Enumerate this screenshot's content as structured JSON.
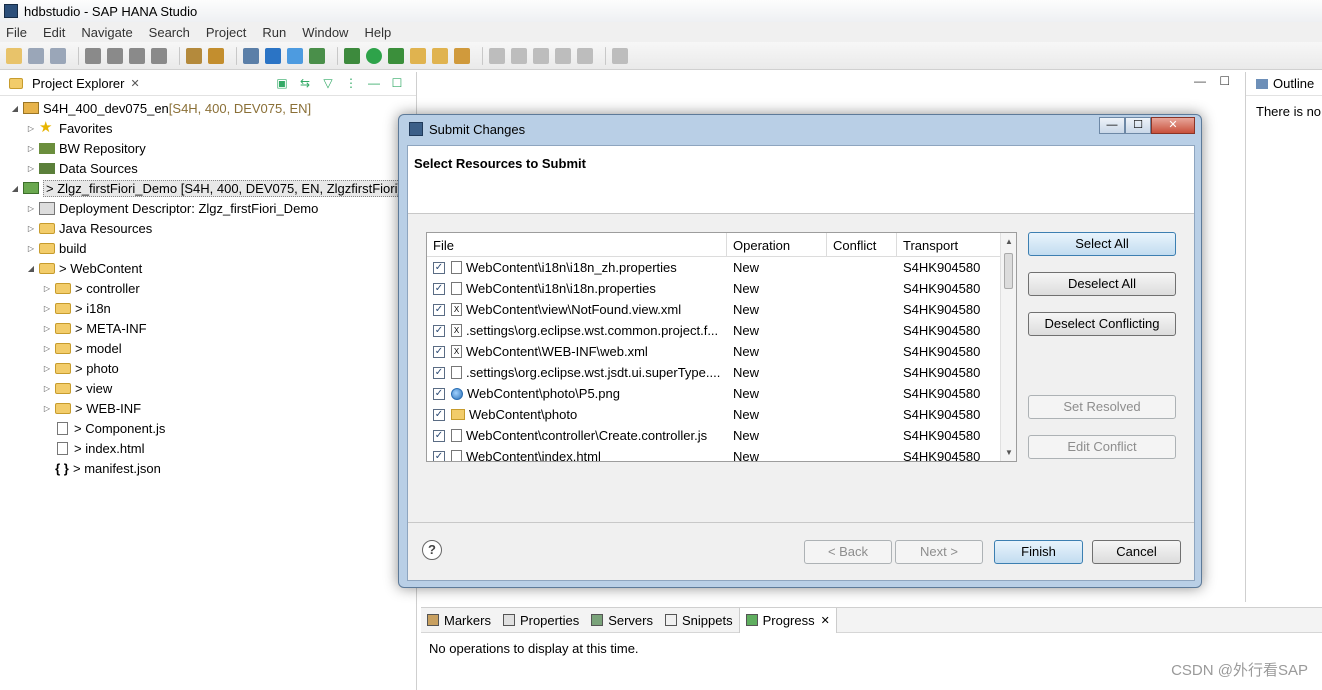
{
  "window": {
    "title": "hdbstudio - SAP HANA Studio"
  },
  "menu": [
    "File",
    "Edit",
    "Navigate",
    "Search",
    "Project",
    "Run",
    "Window",
    "Help"
  ],
  "explorer": {
    "tab_label": "Project Explorer",
    "close_glyph": "✕",
    "tree": [
      {
        "label": "S4H_400_dev075_en",
        "suffix": " [S4H, 400, DEV075, EN]"
      },
      {
        "label": "Favorites"
      },
      {
        "label": "BW Repository"
      },
      {
        "label": "Data Sources"
      },
      {
        "label": "> Zlgz_firstFiori_Demo [S4H, 400, DEV075, EN, ZlgzfirstFiori]"
      },
      {
        "label": "Deployment Descriptor: Zlgz_firstFiori_Demo"
      },
      {
        "label": "Java Resources"
      },
      {
        "label": "build"
      },
      {
        "label": "> WebContent"
      },
      {
        "label": "> controller"
      },
      {
        "label": "> i18n"
      },
      {
        "label": "> META-INF"
      },
      {
        "label": "> model"
      },
      {
        "label": "> photo"
      },
      {
        "label": "> view"
      },
      {
        "label": "> WEB-INF"
      },
      {
        "label": "> Component.js"
      },
      {
        "label": "> index.html"
      },
      {
        "label": "> manifest.json"
      }
    ]
  },
  "outline": {
    "tab_label": "Outline",
    "message": "There is no"
  },
  "bottom_panel": {
    "tabs": [
      "Markers",
      "Properties",
      "Servers",
      "Snippets",
      "Progress"
    ],
    "message": "No operations to display at this time."
  },
  "dialog": {
    "title": "Submit Changes",
    "heading": "Select Resources to Submit",
    "columns": [
      "File",
      "Operation",
      "Conflict",
      "Transport"
    ],
    "rows": [
      {
        "file": "WebContent\\i18n\\i18n_zh.properties",
        "operation": "New",
        "conflict": "",
        "transport": "S4HK904580",
        "icon": "file"
      },
      {
        "file": "WebContent\\i18n\\i18n.properties",
        "operation": "New",
        "conflict": "",
        "transport": "S4HK904580",
        "icon": "file"
      },
      {
        "file": "WebContent\\view\\NotFound.view.xml",
        "operation": "New",
        "conflict": "",
        "transport": "S4HK904580",
        "icon": "xml"
      },
      {
        "file": ".settings\\org.eclipse.wst.common.project.f...",
        "operation": "New",
        "conflict": "",
        "transport": "S4HK904580",
        "icon": "xml"
      },
      {
        "file": "WebContent\\WEB-INF\\web.xml",
        "operation": "New",
        "conflict": "",
        "transport": "S4HK904580",
        "icon": "xml"
      },
      {
        "file": ".settings\\org.eclipse.wst.jsdt.ui.superType....",
        "operation": "New",
        "conflict": "",
        "transport": "S4HK904580",
        "icon": "file"
      },
      {
        "file": "WebContent\\photo\\P5.png",
        "operation": "New",
        "conflict": "",
        "transport": "S4HK904580",
        "icon": "globe"
      },
      {
        "file": "WebContent\\photo",
        "operation": "New",
        "conflict": "",
        "transport": "S4HK904580",
        "icon": "folder"
      },
      {
        "file": "WebContent\\controller\\Create.controller.js",
        "operation": "New",
        "conflict": "",
        "transport": "S4HK904580",
        "icon": "file"
      },
      {
        "file": "WebContent\\index.html",
        "operation": "New",
        "conflict": "",
        "transport": "S4HK904580",
        "icon": "file"
      }
    ],
    "buttons": {
      "select_all": "Select All",
      "deselect_all": "Deselect All",
      "deselect_conflicting": "Deselect Conflicting",
      "set_resolved": "Set Resolved",
      "edit_conflict": "Edit Conflict",
      "back": "< Back",
      "next": "Next >",
      "finish": "Finish",
      "cancel": "Cancel"
    },
    "help_glyph": "?"
  },
  "watermark": "CSDN @外行看SAP"
}
